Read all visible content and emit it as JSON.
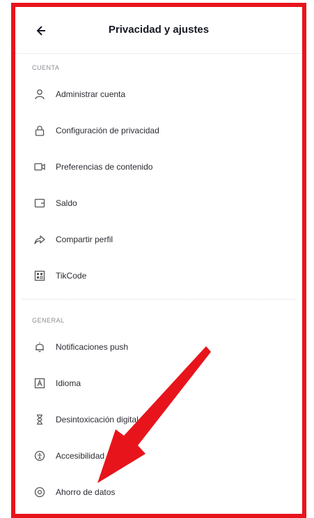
{
  "header": {
    "title": "Privacidad y ajustes"
  },
  "sections": {
    "cuenta": {
      "label": "CUENTA",
      "items": [
        {
          "label": "Administrar cuenta",
          "icon": "person-icon"
        },
        {
          "label": "Configuración de privacidad",
          "icon": "lock-icon"
        },
        {
          "label": "Preferencias de contenido",
          "icon": "video-icon"
        },
        {
          "label": "Saldo",
          "icon": "wallet-icon"
        },
        {
          "label": "Compartir perfil",
          "icon": "share-icon"
        },
        {
          "label": "TikCode",
          "icon": "qr-code-icon"
        }
      ]
    },
    "general": {
      "label": "GENERAL",
      "items": [
        {
          "label": "Notificaciones push",
          "icon": "bell-icon"
        },
        {
          "label": "Idioma",
          "icon": "language-icon"
        },
        {
          "label": "Desintoxicación digital",
          "icon": "hourglass-icon"
        },
        {
          "label": "Accesibilidad",
          "icon": "accessibility-icon"
        },
        {
          "label": "Ahorro de datos",
          "icon": "data-saver-icon"
        }
      ]
    }
  },
  "colors": {
    "frame": "#e8141c",
    "arrow": "#e8141c",
    "text": "#2b2c33",
    "muted": "#8a8b91"
  }
}
